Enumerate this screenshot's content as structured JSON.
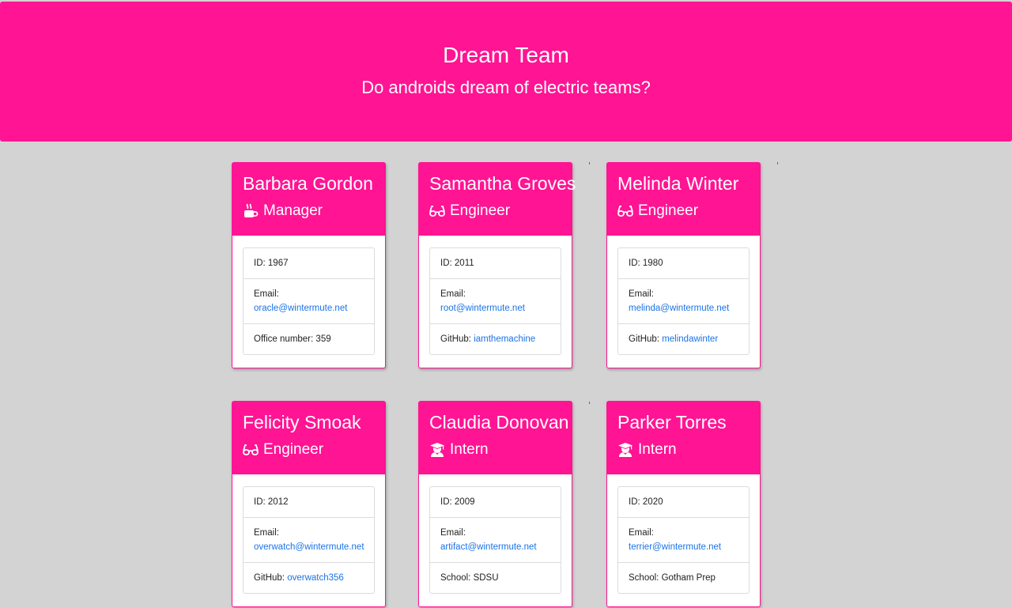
{
  "header": {
    "title": "Dream Team",
    "subtitle": "Do androids dream of electric teams?"
  },
  "colors": {
    "accent": "#ff1493",
    "background": "#d3d3d3",
    "link": "#1a73e8"
  },
  "employees": [
    {
      "name": "Barbara Gordon",
      "role": "Manager",
      "icon": "mug-icon",
      "id_label": "ID:",
      "id": "1967",
      "email_label": "Email:",
      "email": "oracle@wintermute.net",
      "extra_label": "Office number:",
      "extra": "359"
    },
    {
      "name": "Samantha Groves",
      "role": "Engineer",
      "icon": "glasses-icon",
      "id_label": "ID:",
      "id": "2011",
      "email_label": "Email:",
      "email": "root@wintermute.net",
      "extra_label": "GitHub:",
      "extra": "iamthemachine"
    },
    {
      "name": "Melinda Winter",
      "role": "Engineer",
      "icon": "glasses-icon",
      "id_label": "ID:",
      "id": "1980",
      "email_label": "Email:",
      "email": "melinda@wintermute.net",
      "extra_label": "GitHub:",
      "extra": "melindawinter"
    },
    {
      "name": "Felicity Smoak",
      "role": "Engineer",
      "icon": "glasses-icon",
      "id_label": "ID:",
      "id": "2012",
      "email_label": "Email:",
      "email": "overwatch@wintermute.net",
      "extra_label": "GitHub:",
      "extra": "overwatch356"
    },
    {
      "name": "Claudia Donovan",
      "role": "Intern",
      "icon": "graduate-icon",
      "id_label": "ID:",
      "id": "2009",
      "email_label": "Email:",
      "email": "artifact@wintermute.net",
      "extra_label": "School:",
      "extra": "SDSU"
    },
    {
      "name": "Parker Torres",
      "role": "Intern",
      "icon": "graduate-icon",
      "id_label": "ID:",
      "id": "2020",
      "email_label": "Email:",
      "email": "terrier@wintermute.net",
      "extra_label": "School:",
      "extra": "Gotham Prep"
    }
  ]
}
